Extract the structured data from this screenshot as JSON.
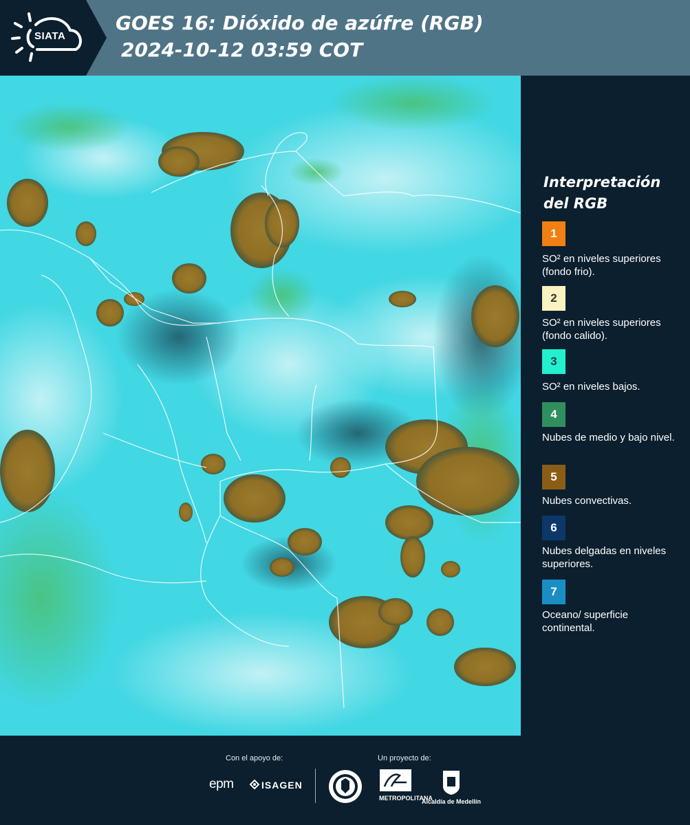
{
  "header": {
    "logo_text": "SIATA",
    "title_line1": "GOES 16: Dióxido de azúfre (RGB)",
    "title_line2": "2024-10-12 03:59 COT"
  },
  "legend": {
    "title_line1": "Interpretación",
    "title_line2": "del RGB",
    "items": [
      {
        "number": "1",
        "color": "#f27f12",
        "number_color": "#ffffff",
        "label": "SO² en niveles superiores (fondo frio)."
      },
      {
        "number": "2",
        "color": "#fbf2c2",
        "number_color": "#333333",
        "label": "SO² en niveles superiores (fondo calido)."
      },
      {
        "number": "3",
        "color": "#22f0cf",
        "number_color": "#2a3a44",
        "label": "SO² en niveles bajos."
      },
      {
        "number": "4",
        "color": "#2f8f5f",
        "number_color": "#ffffff",
        "label": "Nubes de medio y bajo nivel."
      },
      {
        "number": "5",
        "color": "#8a5d16",
        "number_color": "#ffffff",
        "label": "Nubes convectivas."
      },
      {
        "number": "6",
        "color": "#0d3768",
        "number_color": "#ffffff",
        "label": "Nubes delgadas en niveles superiores."
      },
      {
        "number": "7",
        "color": "#1a8ec4",
        "number_color": "#ffffff",
        "label": "Oceano/ superficie continental."
      }
    ]
  },
  "footer": {
    "support_label": "Con el apoyo de:",
    "project_label": "Un proyecto de:",
    "sponsor_epm": "epm",
    "sponsor_isagen": "ISAGEN",
    "partner_area_caption": "METROPOLITANA",
    "partner_alcaldia": "Alcaldía de Medellín"
  },
  "colors": {
    "background": "#0b1f2e",
    "header": "#4f7486",
    "map_base": "#3ed8e4"
  }
}
